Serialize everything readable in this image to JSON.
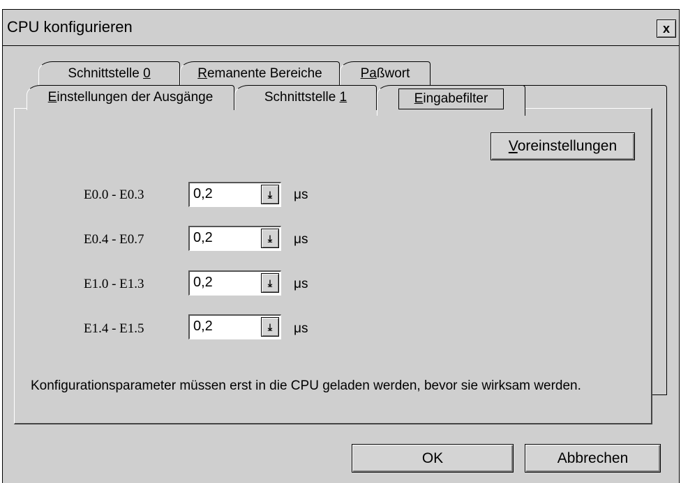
{
  "window": {
    "title": "CPU konfigurieren",
    "close_label": "x"
  },
  "tabs_row_back": [
    {
      "pre": "Schnittstelle ",
      "ul": "0",
      "post": ""
    },
    {
      "pre": "",
      "ul": "R",
      "post": "emanente Bereiche"
    },
    {
      "pre": "",
      "ul": "Pa",
      "post": "ßwort"
    }
  ],
  "tabs_row_front": [
    {
      "pre": "",
      "ul": "E",
      "post": "instellungen der Ausgänge"
    },
    {
      "pre": "Schnittstelle ",
      "ul": "1",
      "post": ""
    },
    {
      "pre": "",
      "ul": "E",
      "post": "ingabefilter"
    }
  ],
  "defaults_button": {
    "ul": "V",
    "post": "oreinstellungen"
  },
  "filters": [
    {
      "label": "E0.0 - E0.3",
      "value": "0,2",
      "unit": "μs"
    },
    {
      "label": "E0.4 - E0.7",
      "value": "0,2",
      "unit": "μs"
    },
    {
      "label": "E1.0 - E1.3",
      "value": "0,2",
      "unit": "μs"
    },
    {
      "label": "E1.4 - E1.5",
      "value": "0,2",
      "unit": "μs"
    }
  ],
  "note": "Konfigurationsparameter müssen erst in die CPU geladen werden, bevor sie wirksam werden.",
  "buttons": {
    "ok": "OK",
    "cancel": "Abbrechen"
  },
  "icons": {
    "dropdown": "arrow-down-bar-icon"
  }
}
